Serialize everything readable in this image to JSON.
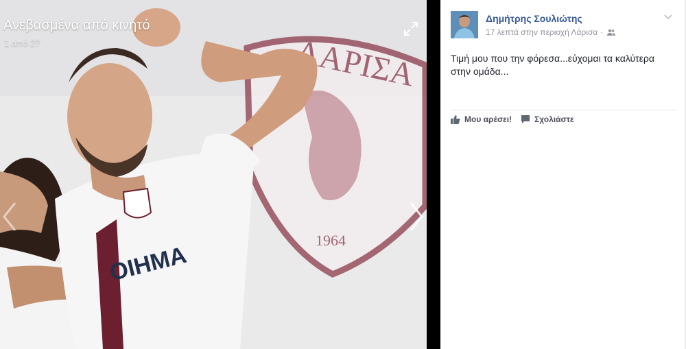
{
  "photo": {
    "album_title": "Ανεβασμένα από κινητό",
    "counter": "1 από 27",
    "background_text": "ΛΑΡΙΣΑ",
    "crest_year": "1964",
    "shirt_sponsor": "ΟΙΗΜΑ"
  },
  "post": {
    "author": "Δημήτρης Σουλιώτης",
    "time_location": "17 λεπτά στην περιοχή Λάρισα",
    "separator": "·",
    "text": "Τιμή μου που την φόρεσα...εύχομαι τα καλύτερα στην ομάδα...",
    "actions": {
      "like": "Μου αρέσει!",
      "comment": "Σχολιάστε"
    }
  },
  "colors": {
    "link_blue": "#365899",
    "maroon": "#7a1f33",
    "meta_gray": "#90949c"
  },
  "icons": [
    "expand-icon",
    "next-arrow-icon",
    "prev-arrow-icon",
    "friends-icon",
    "chevron-down-icon",
    "like-icon",
    "comment-icon"
  ]
}
